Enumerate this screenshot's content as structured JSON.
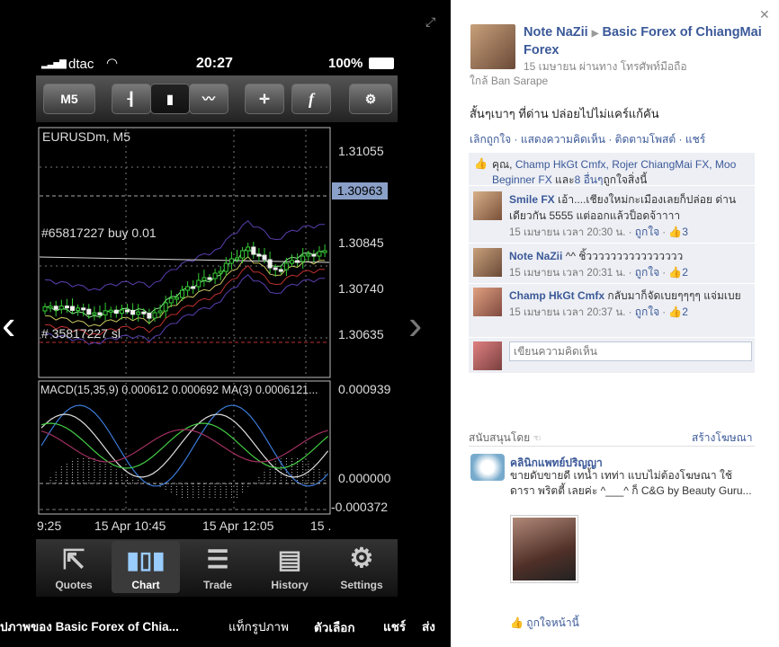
{
  "phone": {
    "carrier": "dtac",
    "time": "20:27",
    "battery": "100%",
    "toolbar": {
      "timeframe": "M5",
      "f_label": "f"
    },
    "chart": {
      "symbol": "EURUSDm, M5",
      "buy_order": "#65817227 buy 0.01",
      "sl_order": "# 35817227 sl",
      "current_price": "1.30963",
      "price_labels": [
        "1.31055",
        "1.30845",
        "1.30740",
        "1.30635"
      ],
      "macd_label": "MACD(15,35,9) 0.000612 0.000692 MA(3) 0.0006121...",
      "macd_labels": [
        "0.000939",
        "0.000000",
        "-0.000372"
      ],
      "time_labels": [
        "9:25",
        "15 Apr 10:45",
        "15 Apr 12:05",
        "15 ."
      ]
    },
    "nav": [
      {
        "label": "Quotes"
      },
      {
        "label": "Chart"
      },
      {
        "label": "Trade"
      },
      {
        "label": "History"
      },
      {
        "label": "Settings"
      }
    ],
    "accent_colors": {
      "candle": "#33cc33",
      "price_tag": "#8aa0c8",
      "grid": "#888888"
    }
  },
  "photo_bar": {
    "caption": "ปภาพของ Basic Forex of Chia...",
    "actions": [
      "แท็กรูปภาพ",
      "ตัวเลือก",
      "แชร์",
      "ส่ง"
    ]
  },
  "post": {
    "author": "Note NaZii",
    "target": "Basic Forex of ChiangMai Forex",
    "date_via": "15 เมษายน ผ่านทาง โทรศัพท์มือถือ",
    "location": "ใกล้ Ban Sarape",
    "text": "สั้นๆเบาๆ ที่ด่าน ปล่อยไปไม่แคร์แก้คัน",
    "actions": [
      "เลิกถูกใจ",
      "แสดงความคิดเห็น",
      "ติดตามโพสต์",
      "แชร์"
    ],
    "likes": {
      "prefix": "คุณ,",
      "names": [
        "Champ HkGt Cmfx,",
        "Rojer ChiangMai FX,",
        "Moo Beginner FX"
      ],
      "and": "และ",
      "others": "8 อื่นๆ",
      "suffix": "ถูกใจสิ่งนี้"
    },
    "comments": [
      {
        "name": "Smile FX",
        "text": "เอ้า....เชียงใหม่กะเมืองเลยก็ปล่อย ด่านเดียวกัน 5555 แต่ออกแล้วป็อดจ้าาาา",
        "time": "15 เมษายน เวลา 20:30 น.",
        "like": "ถูกใจ",
        "count": "3"
      },
      {
        "name": "Note NaZii",
        "text": "^^ ชิ้วววววววววววววววว",
        "time": "15 เมษายน เวลา 20:31 น.",
        "like": "ถูกใจ",
        "count": "2"
      },
      {
        "name": "Champ HkGt Cmfx",
        "text": "กลับมาก็จัดเบยๆๆๆๆ แจ่มเบย",
        "time": "15 เมษายน เวลา 20:37 น.",
        "like": "ถูกใจ",
        "count": "2"
      }
    ],
    "comment_placeholder": "เขียนความคิดเห็น"
  },
  "sponsored": {
    "heading": "สนับสนุนโดย",
    "create_ad": "สร้างโฆษณา",
    "ad_title": "คลินิกแพทย์ปริญญา",
    "ad_text": "ขายดับขายดี เทน้ำ เทท่า แบบไม่ต้องโฆษณา ใช้ ดารา พริตตี้ เลยค่ะ ^___^ ก็ C&G by Beauty Guru...",
    "like_page": "ถูกใจหน้านี้"
  }
}
